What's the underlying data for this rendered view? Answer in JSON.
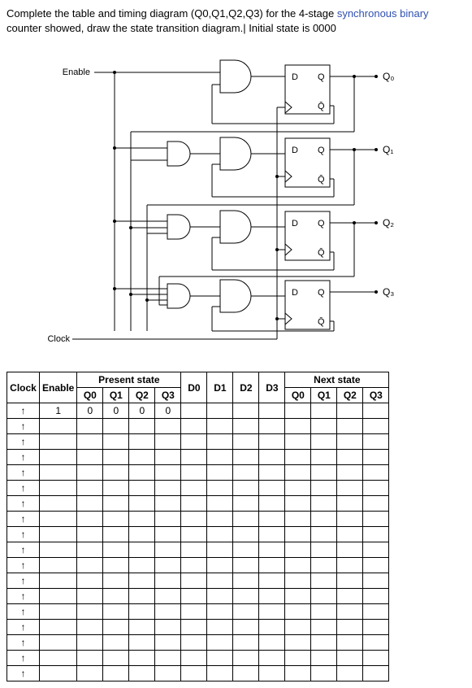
{
  "prompt_a": "Complete the table and timing diagram (Q0,Q1,Q2,Q3) for the 4-stage ",
  "prompt_syn": "synchronous binary",
  "prompt_b": " counter showed, draw the state transition diagram.| Initial state is 0000",
  "circuit": {
    "enable": "Enable",
    "clock": "Clock",
    "d": "D",
    "q": "Q",
    "qbar": "Q̄",
    "q0": "Q₀",
    "q1": "Q₁",
    "q2": "Q₂",
    "q3": "Q₃"
  },
  "table": {
    "present_state": "Present state",
    "next_state": "Next state",
    "headers": [
      "Clock",
      "Enable",
      "Q0",
      "Q1",
      "Q2",
      "Q3",
      "D0",
      "D1",
      "D2",
      "D3",
      "Q0",
      "Q1",
      "Q2",
      "Q3"
    ],
    "rows": [
      [
        "↑",
        "1",
        "0",
        "0",
        "0",
        "0",
        "",
        "",
        "",
        "",
        "",
        "",
        "",
        ""
      ],
      [
        "↑",
        "",
        "",
        "",
        "",
        "",
        "",
        "",
        "",
        "",
        "",
        "",
        "",
        ""
      ],
      [
        "↑",
        "",
        "",
        "",
        "",
        "",
        "",
        "",
        "",
        "",
        "",
        "",
        "",
        ""
      ],
      [
        "↑",
        "",
        "",
        "",
        "",
        "",
        "",
        "",
        "",
        "",
        "",
        "",
        "",
        ""
      ],
      [
        "↑",
        "",
        "",
        "",
        "",
        "",
        "",
        "",
        "",
        "",
        "",
        "",
        "",
        ""
      ],
      [
        "↑",
        "",
        "",
        "",
        "",
        "",
        "",
        "",
        "",
        "",
        "",
        "",
        "",
        ""
      ],
      [
        "↑",
        "",
        "",
        "",
        "",
        "",
        "",
        "",
        "",
        "",
        "",
        "",
        "",
        ""
      ],
      [
        "↑",
        "",
        "",
        "",
        "",
        "",
        "",
        "",
        "",
        "",
        "",
        "",
        "",
        ""
      ],
      [
        "↑",
        "",
        "",
        "",
        "",
        "",
        "",
        "",
        "",
        "",
        "",
        "",
        "",
        ""
      ],
      [
        "↑",
        "",
        "",
        "",
        "",
        "",
        "",
        "",
        "",
        "",
        "",
        "",
        "",
        ""
      ],
      [
        "↑",
        "",
        "",
        "",
        "",
        "",
        "",
        "",
        "",
        "",
        "",
        "",
        "",
        ""
      ],
      [
        "↑",
        "",
        "",
        "",
        "",
        "",
        "",
        "",
        "",
        "",
        "",
        "",
        "",
        ""
      ],
      [
        "↑",
        "",
        "",
        "",
        "",
        "",
        "",
        "",
        "",
        "",
        "",
        "",
        "",
        ""
      ],
      [
        "↑",
        "",
        "",
        "",
        "",
        "",
        "",
        "",
        "",
        "",
        "",
        "",
        "",
        ""
      ],
      [
        "↑",
        "",
        "",
        "",
        "",
        "",
        "",
        "",
        "",
        "",
        "",
        "",
        "",
        ""
      ],
      [
        "↑",
        "",
        "",
        "",
        "",
        "",
        "",
        "",
        "",
        "",
        "",
        "",
        "",
        ""
      ],
      [
        "↑",
        "",
        "",
        "",
        "",
        "",
        "",
        "",
        "",
        "",
        "",
        "",
        "",
        ""
      ],
      [
        "↑",
        "",
        "",
        "",
        "",
        "",
        "",
        "",
        "",
        "",
        "",
        "",
        "",
        ""
      ]
    ]
  }
}
